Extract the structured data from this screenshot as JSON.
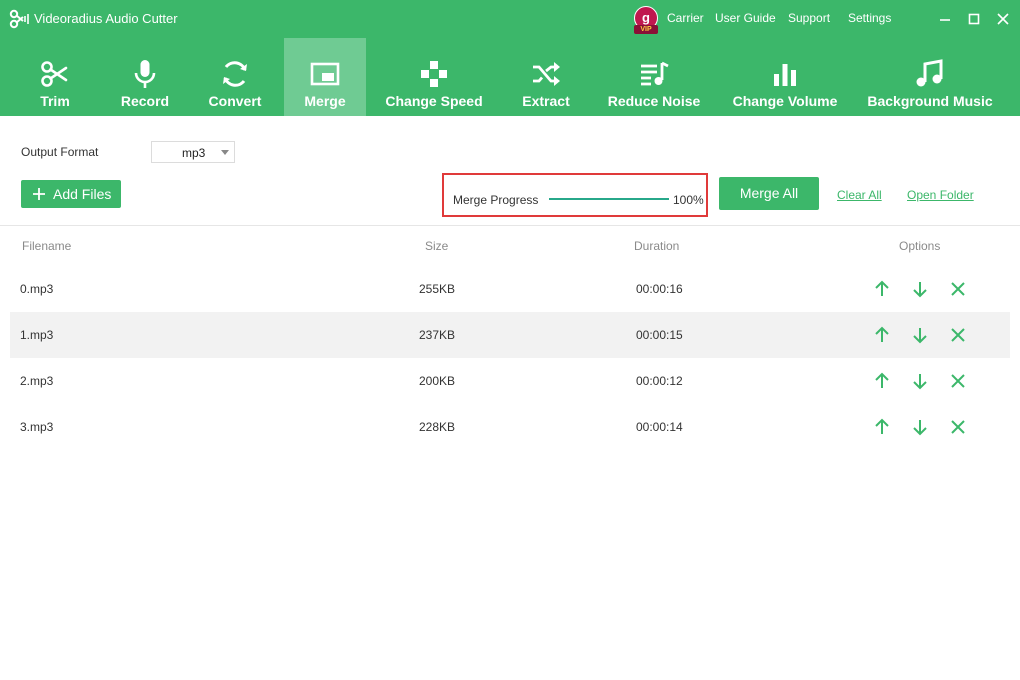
{
  "app": {
    "title": "Videoradius Audio Cutter"
  },
  "vip": {
    "letter": "g",
    "badge": "VIP"
  },
  "top_links": {
    "carrier": "Carrier",
    "user_guide": "User Guide",
    "support": "Support",
    "settings": "Settings"
  },
  "toolbar": {
    "items": [
      {
        "label": "Trim",
        "icon": "scissors-icon"
      },
      {
        "label": "Record",
        "icon": "microphone-icon"
      },
      {
        "label": "Convert",
        "icon": "refresh-icon"
      },
      {
        "label": "Merge",
        "icon": "merge-icon",
        "active": true
      },
      {
        "label": "Change Speed",
        "icon": "gamepad-icon"
      },
      {
        "label": "Extract",
        "icon": "shuffle-icon"
      },
      {
        "label": "Reduce Noise",
        "icon": "playlist-icon"
      },
      {
        "label": "Change Volume",
        "icon": "bar-chart-icon"
      },
      {
        "label": "Background Music",
        "icon": "music-note-icon"
      }
    ]
  },
  "controls": {
    "output_format_label": "Output Format",
    "output_format_value": "mp3",
    "add_files_label": "Add Files",
    "merge_progress_label": "Merge Progress",
    "merge_progress_text": "100%",
    "merge_progress_fraction": 1.0,
    "merge_all_label": "Merge All",
    "clear_all_label": "Clear All",
    "open_folder_label": "Open Folder"
  },
  "table": {
    "columns": {
      "filename": "Filename",
      "size": "Size",
      "duration": "Duration",
      "options": "Options"
    },
    "rows": [
      {
        "filename": "0.mp3",
        "size": "255KB",
        "duration": "00:00:16"
      },
      {
        "filename": "1.mp3",
        "size": "237KB",
        "duration": "00:00:15"
      },
      {
        "filename": "2.mp3",
        "size": "200KB",
        "duration": "00:00:12"
      },
      {
        "filename": "3.mp3",
        "size": "228KB",
        "duration": "00:00:14"
      }
    ]
  },
  "colors": {
    "brand": "#3cb76a",
    "active_tab": "#6fcb93",
    "highlight": "#e03a3a",
    "progress": "#27a88a"
  }
}
